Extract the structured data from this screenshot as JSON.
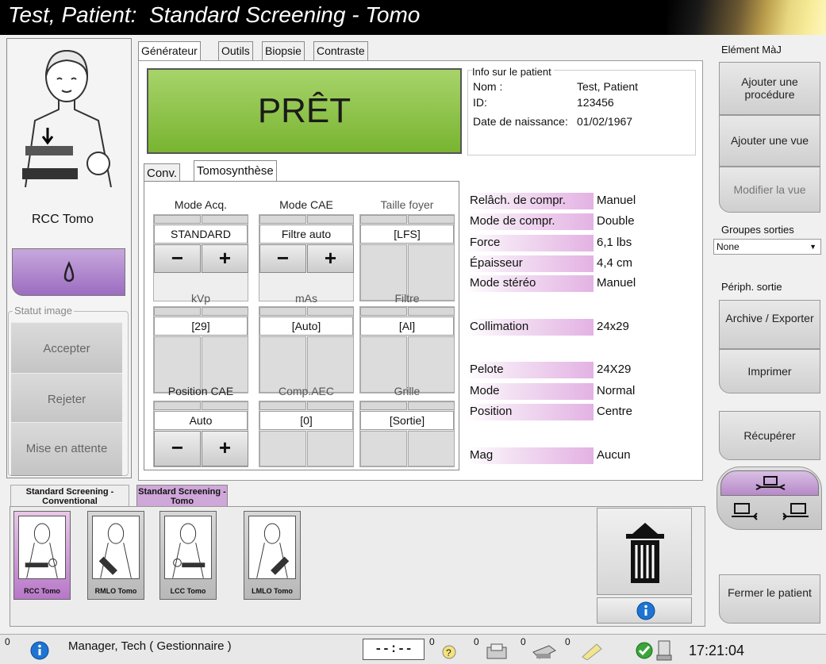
{
  "title": "Test, Patient:  Standard Screening - Tomo",
  "procedure_view": "RCC Tomo",
  "status_image": {
    "title": "Statut image",
    "accept": "Accepter",
    "reject": "Rejeter",
    "pending": "Mise en attente"
  },
  "tabs": [
    "Générateur",
    "Outils",
    "Biopsie",
    "Contraste"
  ],
  "ready_text": "PRÊT",
  "patient_info": {
    "title": "Info sur le patient",
    "name_label": "Nom :",
    "name": "Test, Patient",
    "id_label": "ID:",
    "id": "123456",
    "dob_label": "Date de naissance:",
    "dob": "01/02/1967"
  },
  "subtabs": [
    "Conv.",
    "Tomosynthèse"
  ],
  "controls": {
    "acq_mode": {
      "label": "Mode Acq.",
      "value": "STANDARD"
    },
    "aec_mode": {
      "label": "Mode CAE",
      "value": "Filtre auto"
    },
    "focal_size": {
      "label": "Taille foyer",
      "value": "[LFS]"
    },
    "kvp": {
      "label": "kVp",
      "value": "[29]"
    },
    "mas": {
      "label": "mAs",
      "value": "[Auto]"
    },
    "filter": {
      "label": "Filtre",
      "value": "[Al]"
    },
    "aec_position": {
      "label": "Position CAE",
      "value": "Auto"
    },
    "aec_comp": {
      "label": "Comp.AEC",
      "value": "[0]"
    },
    "grid": {
      "label": "Grille",
      "value": "[Sortie]"
    },
    "minus": "−",
    "plus": "+"
  },
  "params": [
    {
      "label": "Relâch. de compr.",
      "value": "Manuel"
    },
    {
      "label": "Mode de compr.",
      "value": "Double"
    },
    {
      "label": "Force",
      "value": "6,1 lbs"
    },
    {
      "label": "Épaisseur",
      "value": "4,4 cm"
    },
    {
      "label": "Mode stéréo",
      "value": "Manuel"
    },
    {
      "label": "Collimation",
      "value": "24x29"
    },
    {
      "label": "Pelote",
      "value": "24X29"
    },
    {
      "label": "Mode",
      "value": "Normal"
    },
    {
      "label": "Position",
      "value": "Centre"
    },
    {
      "label": "Mag",
      "value": "Aucun"
    }
  ],
  "right_panel": {
    "update_title": "Elément MàJ",
    "add_procedure": "Ajouter une procédure",
    "add_view": "Ajouter une vue",
    "edit_view": "Modifier la vue",
    "output_groups_title": "Groupes sorties",
    "output_group_value": "None",
    "output_devices_title": "Périph. sortie",
    "archive": "Archive / Exporter",
    "print": "Imprimer",
    "retrieve": "Récupérer",
    "close_patient": "Fermer le patient"
  },
  "procedure_tabs": [
    "Standard Screening - Conventional",
    "Standard Screening - Tomo"
  ],
  "thumbnails": [
    "RCC Tomo",
    "RMLO Tomo",
    "LCC Tomo",
    "LMLO Tomo"
  ],
  "status_bar": {
    "count_info": "0",
    "user": "Manager, Tech ( Gestionnaire )",
    "timer": "--:--",
    "count1": "0",
    "count2": "0",
    "count3": "0",
    "count4": "0",
    "time": "17:21:04"
  },
  "colors": {
    "ready": "#86c241",
    "accent_purple": "#b78ac8",
    "title_bg": "#000000"
  }
}
